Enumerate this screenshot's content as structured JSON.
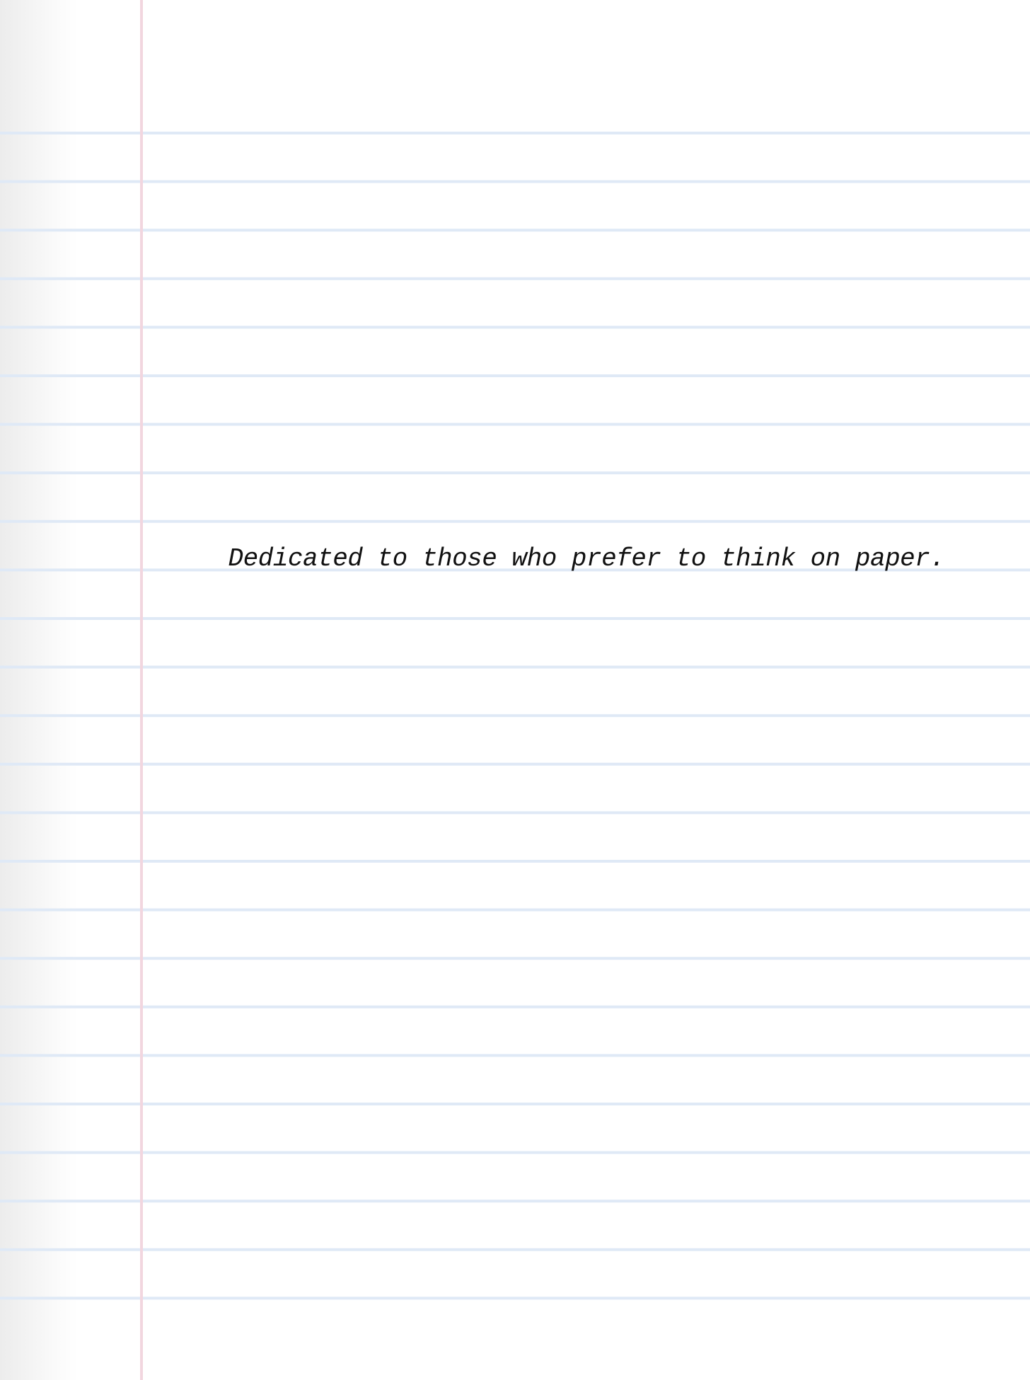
{
  "dedication": {
    "text": "Dedicated to those who prefer to think on paper."
  },
  "colors": {
    "paper": "#ffffff",
    "rule_line": "#dfe9f6",
    "margin_line": "#f2d6df",
    "text": "#111111"
  }
}
